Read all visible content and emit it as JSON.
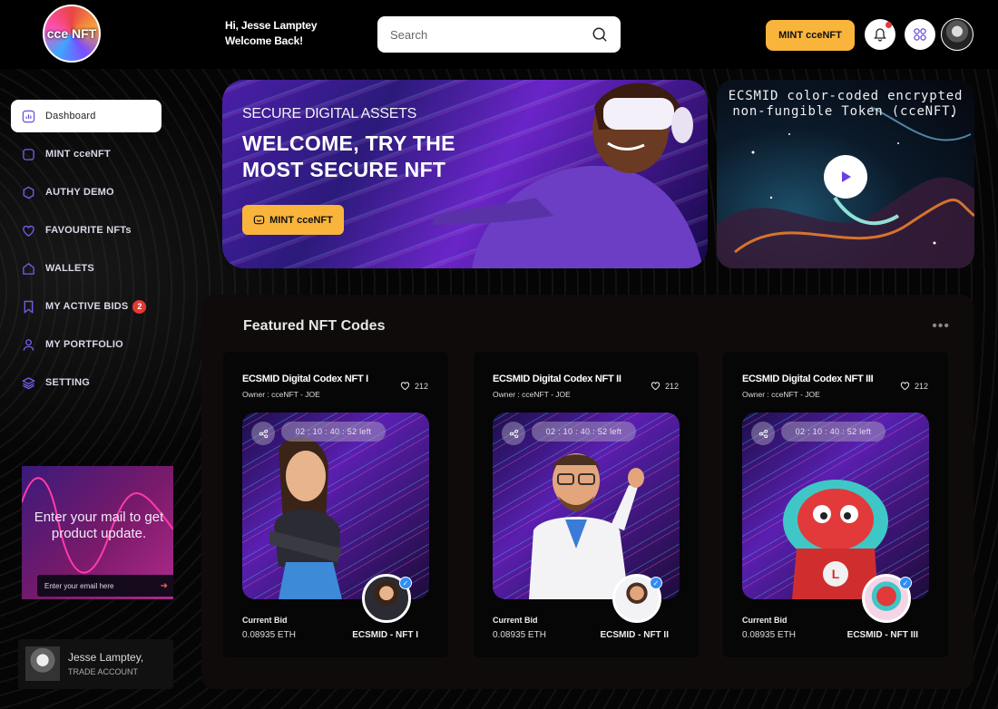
{
  "header": {
    "logo_text": "cce NFT",
    "greeting_line1": "Hi, Jesse Lamptey",
    "greeting_line2": "Welcome Back!",
    "search_placeholder": "Search",
    "mint_button": "MINT cceNFT",
    "accent_color": "#f9b43c"
  },
  "sidebar": {
    "items": [
      {
        "label": "Dashboard",
        "icon": "dashboard-icon",
        "active": true
      },
      {
        "label": "MINT cceNFT",
        "icon": "square-icon"
      },
      {
        "label": "AUTHY DEMO",
        "icon": "hexagon-icon"
      },
      {
        "label": "FAVOURITE NFTs",
        "icon": "heart-icon"
      },
      {
        "label": "WALLETS",
        "icon": "wallet-icon"
      },
      {
        "label": "MY ACTIVE BIDS",
        "icon": "bookmark-icon",
        "badge": "2"
      },
      {
        "label": "MY PORTFOLIO",
        "icon": "user-icon"
      },
      {
        "label": "SETTING",
        "icon": "layers-icon"
      }
    ],
    "promo": {
      "text": "Enter your mail to get product update.",
      "input_placeholder": "Enter your email here"
    },
    "profile": {
      "name": "Jesse Lamptey,",
      "role": "TRADE ACCOUNT"
    }
  },
  "hero": {
    "subtitle": "SECURE DIGITAL ASSETS",
    "title": "WELCOME, TRY THE MOST SECURE NFT",
    "button": "MINT cceNFT"
  },
  "video": {
    "title": "ECSMID color-coded encrypted non-fungible Token (cceNFT)"
  },
  "featured": {
    "title": "Featured NFT Codes",
    "more": "•••",
    "cards": [
      {
        "title": "ECSMID Digital Codex NFT I",
        "owner": "Owner : cceNFT - JOE",
        "likes": "212",
        "timer": "02 : 10 : 40 : 52 left",
        "bid_label": "Current Bid",
        "bid_value": "0.08935 ETH",
        "name": "ECSMID - NFT I"
      },
      {
        "title": "ECSMID Digital Codex NFT II",
        "owner": "Owner : cceNFT - JOE",
        "likes": "212",
        "timer": "02 : 10 : 40 : 52 left",
        "bid_label": "Current Bid",
        "bid_value": "0.08935 ETH",
        "name": "ECSMID - NFT II"
      },
      {
        "title": "ECSMID Digital Codex NFT III",
        "owner": "Owner : cceNFT - JOE",
        "likes": "212",
        "timer": "02 : 10 : 40 : 52 left",
        "bid_label": "Current Bid",
        "bid_value": "0.08935 ETH",
        "name": "ECSMID - NFT III"
      }
    ]
  }
}
